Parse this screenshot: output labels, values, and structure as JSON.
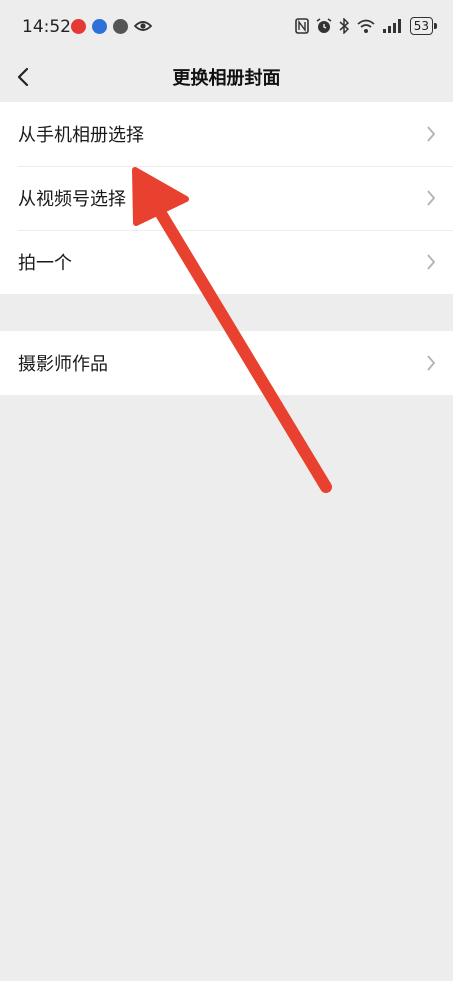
{
  "status_bar": {
    "time": "14:52",
    "battery": "53",
    "notification_colors": [
      "#e53935",
      "#2f6fd8",
      "#555555"
    ],
    "icons": [
      "eye-icon",
      "nfc-icon",
      "alarm-icon",
      "bluetooth-icon",
      "wifi-icon",
      "signal-icon",
      "battery-icon"
    ]
  },
  "nav": {
    "title": "更换相册封面",
    "back_icon": "chevron-left-icon"
  },
  "options": {
    "group1": [
      {
        "label": "从手机相册选择"
      },
      {
        "label": "从视频号选择"
      },
      {
        "label": "拍一个"
      }
    ],
    "group2": [
      {
        "label": "摄影师作品"
      }
    ]
  },
  "annotation": {
    "color": "#e8412f",
    "icon": "red-arrow-pointer"
  }
}
